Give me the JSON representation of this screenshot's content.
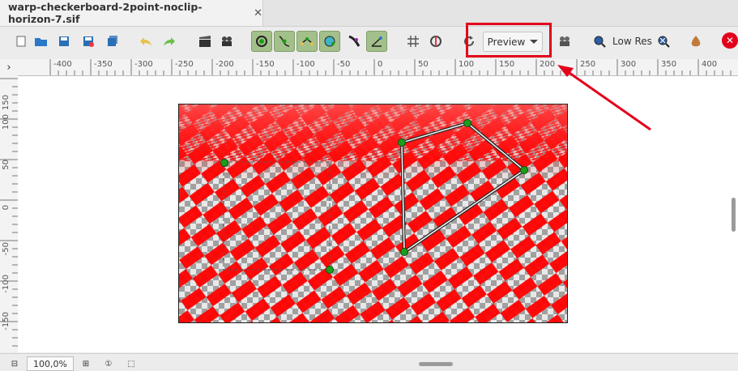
{
  "tab": {
    "title": "warp-checkerboard-2point-noclip-horizon-7.sif",
    "close_glyph": "✕"
  },
  "toolbar": {
    "tools_left": [
      "new-file-icon",
      "open-file-icon",
      "save-icon",
      "save-as-icon",
      "save-all-icon",
      "undo-icon",
      "redo-icon",
      "render-clapper-icon",
      "preview-camera-icon"
    ],
    "toggles": [
      "show-position-handles-icon",
      "show-vertex-handles-icon",
      "show-tangent-handles-icon",
      "show-radius-handles-icon",
      "show-width-handles-icon",
      "show-angle-handles-icon"
    ],
    "preview_label": "Preview",
    "lowres_label": "Low Res",
    "close_glyph": "✕"
  },
  "ruler": {
    "horizontal_labels": [
      "-400",
      "-350",
      "-300",
      "-250",
      "-200",
      "-150",
      "-100",
      "-50",
      "0",
      "50",
      "100",
      "150",
      "200",
      "250",
      "300",
      "350",
      "400"
    ],
    "vertical_labels": [
      "150",
      "100",
      "50",
      "0",
      "-50",
      "-100",
      "-150"
    ]
  },
  "status": {
    "zoom": "100,0%"
  },
  "colors": {
    "checker_red": "#ff0000",
    "checker_light": "#e8e8e8",
    "checker_dark": "#a0a0a0",
    "handle_green": "#1b9e1b",
    "highlight": "#e3001b"
  }
}
